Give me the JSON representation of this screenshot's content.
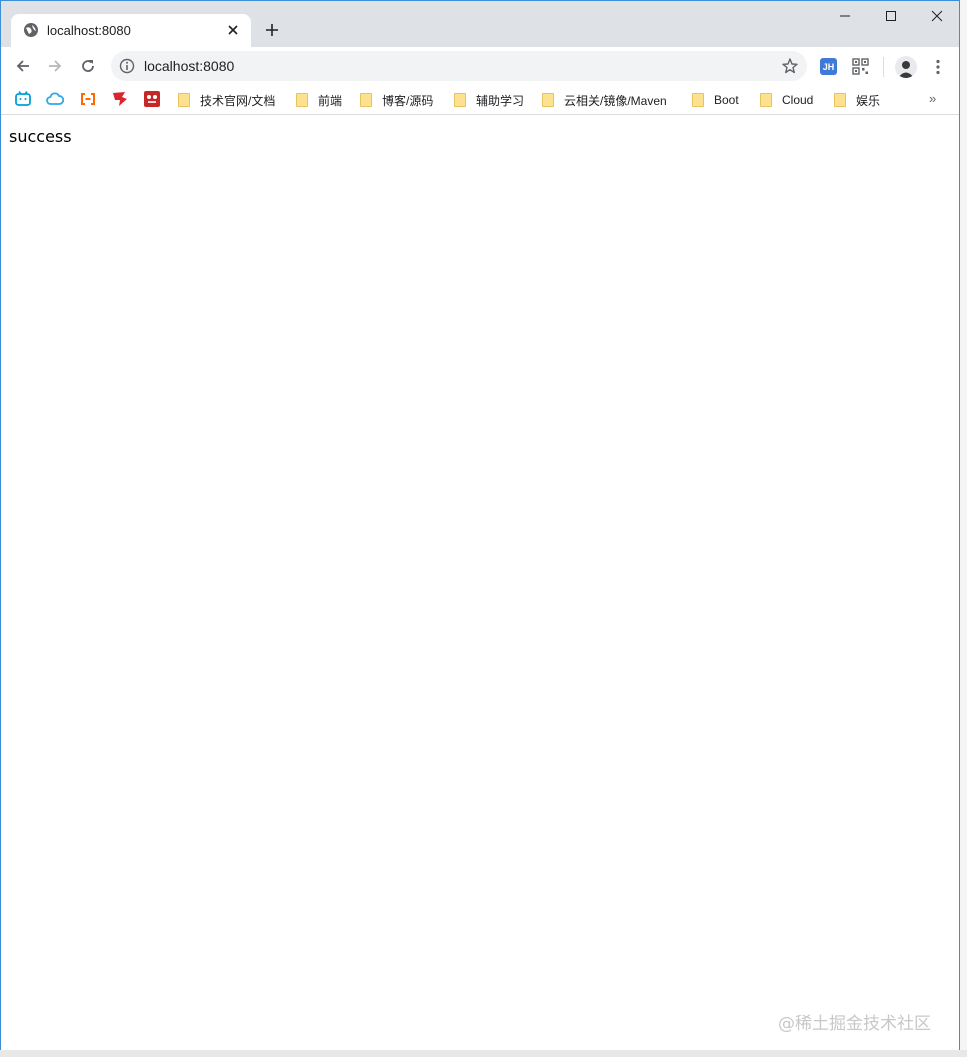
{
  "tab": {
    "title": "localhost:8080",
    "icon": "globe-icon"
  },
  "address_bar": {
    "url": "localhost:8080"
  },
  "extensions": {
    "jh_label": "JH"
  },
  "bookmarks": {
    "icons": [
      "bilibili-icon",
      "cloud-icon",
      "aliyun-icon",
      "ruoyi-icon",
      "red-app-icon"
    ],
    "folders": [
      {
        "label": "技术官网/文档"
      },
      {
        "label": "前端"
      },
      {
        "label": "博客/源码"
      },
      {
        "label": "辅助学习"
      },
      {
        "label": "云相关/镜像/Maven"
      },
      {
        "label": "Boot"
      },
      {
        "label": "Cloud"
      },
      {
        "label": "娱乐"
      }
    ],
    "more": "»"
  },
  "page": {
    "body_text": "success"
  },
  "watermark": "@稀土掘金技术社区",
  "colors": {
    "window_border": "#3c8ed6",
    "tabstrip": "#dee1e6",
    "omnibox": "#f1f3f4",
    "folder": "#fce18f"
  }
}
